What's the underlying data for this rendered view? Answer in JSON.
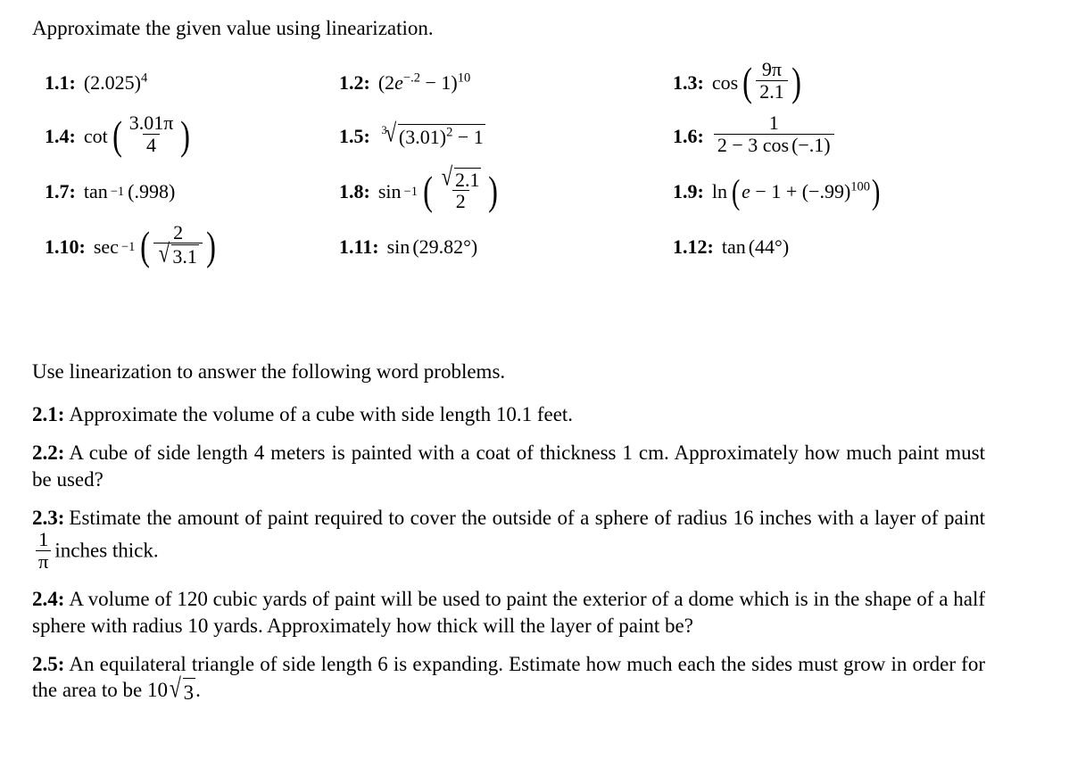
{
  "document": {
    "section1_heading": "Approximate the given value using linearization.",
    "section2_heading": "Use linearization to answer the following word problems."
  },
  "problems_1": [
    {
      "label": "1.1:",
      "base": "(2.025)",
      "exp": "4"
    },
    {
      "label": "1.2:",
      "lead": "(2",
      "var": "e",
      "exp_inner": "−.2",
      "mid": " − 1)",
      "exp": "10"
    },
    {
      "label": "1.3:",
      "fn": "cos",
      "num": "9π",
      "den": "2.1"
    },
    {
      "label": "1.4:",
      "fn": "cot",
      "num": "3.01π",
      "den": "4"
    },
    {
      "label": "1.5:",
      "rootindex": "3",
      "radicand": "(3.01)",
      "radicand_exp": "2",
      "radicand_tail": " − 1"
    },
    {
      "label": "1.6:",
      "num": "1",
      "den_a": "2 − 3",
      "den_fn": "cos",
      "den_b": "(−.1)"
    },
    {
      "label": "1.7:",
      "fn": "tan",
      "inv": "−1",
      "arg": "(.998)"
    },
    {
      "label": "1.8:",
      "fn": "sin",
      "inv": "−1",
      "num_radicand": "2.1",
      "den": "2"
    },
    {
      "label": "1.9:",
      "fn": "ln",
      "arg_a": "e",
      "arg_b": " − 1 + (−.99)",
      "exp": "100"
    },
    {
      "label": "1.10:",
      "fn": "sec",
      "inv": "−1",
      "num": "2",
      "den_radicand": "3.1"
    },
    {
      "label": "1.11:",
      "fn": "sin",
      "arg": "(29.82°)"
    },
    {
      "label": "1.12:",
      "fn": "tan",
      "arg": "(44°)"
    }
  ],
  "problems_2": [
    {
      "label": "2.1:",
      "text": "Approximate the volume of a cube with side length 10.1 feet."
    },
    {
      "label": "2.2:",
      "text": "A cube of side length 4 meters is painted with a coat of thickness 1 cm. Approximately how much paint must be used?"
    },
    {
      "label": "2.3:",
      "text_a": "Estimate the amount of paint required to cover the outside of a sphere of radius 16 inches with a layer of paint",
      "frac_num": "1",
      "frac_den": "π",
      "text_b": "inches thick."
    },
    {
      "label": "2.4:",
      "text": "A volume of 120 cubic yards of paint will be used to paint the exterior of a dome which is in the shape of a half sphere with radius 10 yards. Approximately how thick will the layer of paint be?"
    },
    {
      "label": "2.5:",
      "text_a": "An equilateral triangle of side length 6 is expanding. Estimate how much each the sides must grow in order for the area to be 10",
      "radicand": "3",
      "text_b": "."
    }
  ],
  "glyphs": {
    "radical": "√",
    "paren_left": "(",
    "paren_right": ")"
  }
}
